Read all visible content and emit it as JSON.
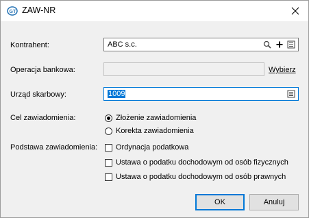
{
  "window": {
    "title": "ZAW-NR",
    "icon": "app-logo-icon",
    "close_icon": "close-icon"
  },
  "form": {
    "kontrahent": {
      "label": "Kontrahent:",
      "value": "ABC s.c.",
      "icons": [
        "search-icon",
        "plus-icon",
        "list-icon"
      ]
    },
    "operacja": {
      "label": "Operacja bankowa:",
      "value": "",
      "link": "Wybierz"
    },
    "urzad": {
      "label": "Urząd skarbowy:",
      "value": "1009",
      "icons": [
        "list-icon"
      ]
    },
    "cel": {
      "label": "Cel zawiadomienia:",
      "options": [
        {
          "label": "Złożenie zawiadomienia",
          "checked": true
        },
        {
          "label": "Korekta zawiadomienia",
          "checked": false
        }
      ]
    },
    "podstawa": {
      "label": "Podstawa zawiadomienia:",
      "options": [
        {
          "label": "Ordynacja podatkowa",
          "checked": false
        },
        {
          "label": "Ustawa o podatku dochodowym od osób fizycznych",
          "checked": false
        },
        {
          "label": "Ustawa o podatku dochodowym od osób prawnych",
          "checked": false
        }
      ]
    }
  },
  "buttons": {
    "ok": "OK",
    "cancel": "Anuluj"
  },
  "colors": {
    "selection": "#0078d7",
    "accent": "#0078d7"
  }
}
